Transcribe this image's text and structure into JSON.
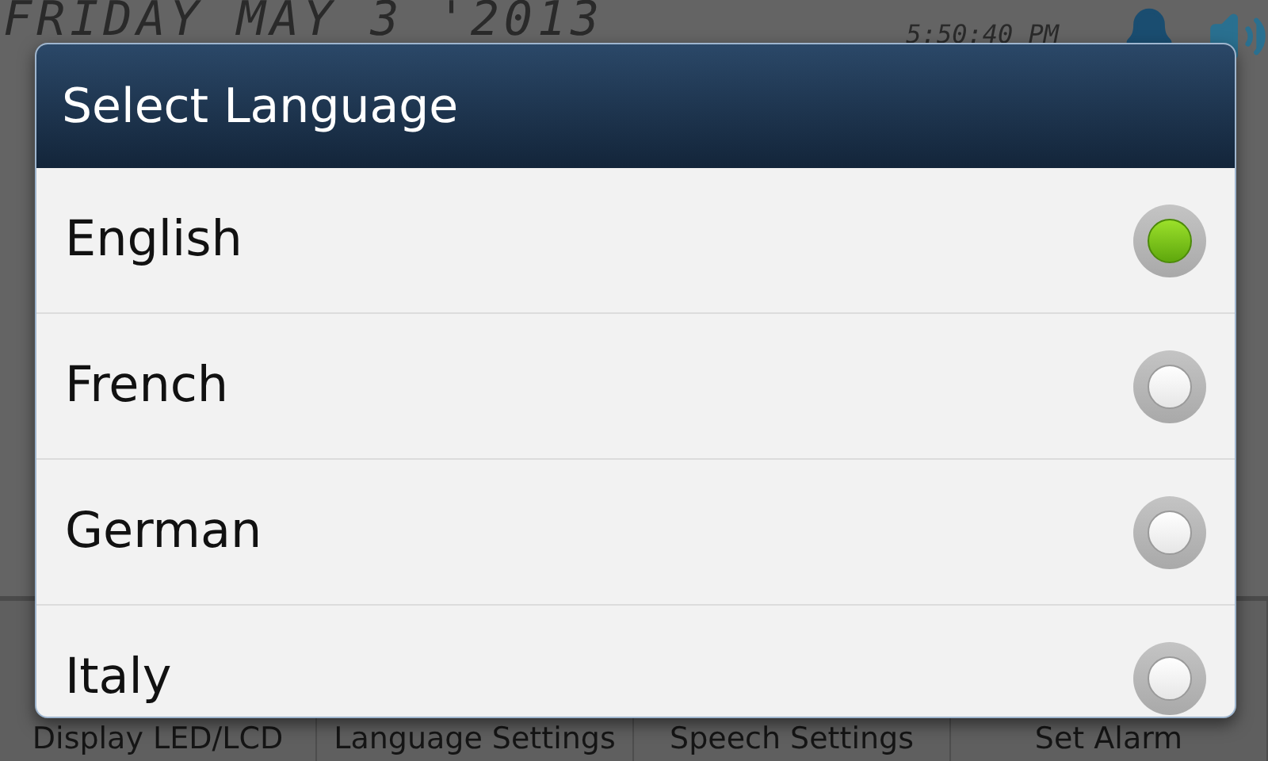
{
  "background": {
    "date": "FRIDAY MAY 3 '2013",
    "time": "5:50:40 PM"
  },
  "dialog": {
    "title": "Select Language",
    "options": [
      {
        "label": "English",
        "selected": true
      },
      {
        "label": "French",
        "selected": false
      },
      {
        "label": "German",
        "selected": false
      },
      {
        "label": "Italy",
        "selected": false
      }
    ]
  },
  "tabs": [
    {
      "label": "Display LED/LCD"
    },
    {
      "label": "Language Settings"
    },
    {
      "label": "Speech Settings"
    },
    {
      "label": "Set Alarm"
    }
  ]
}
